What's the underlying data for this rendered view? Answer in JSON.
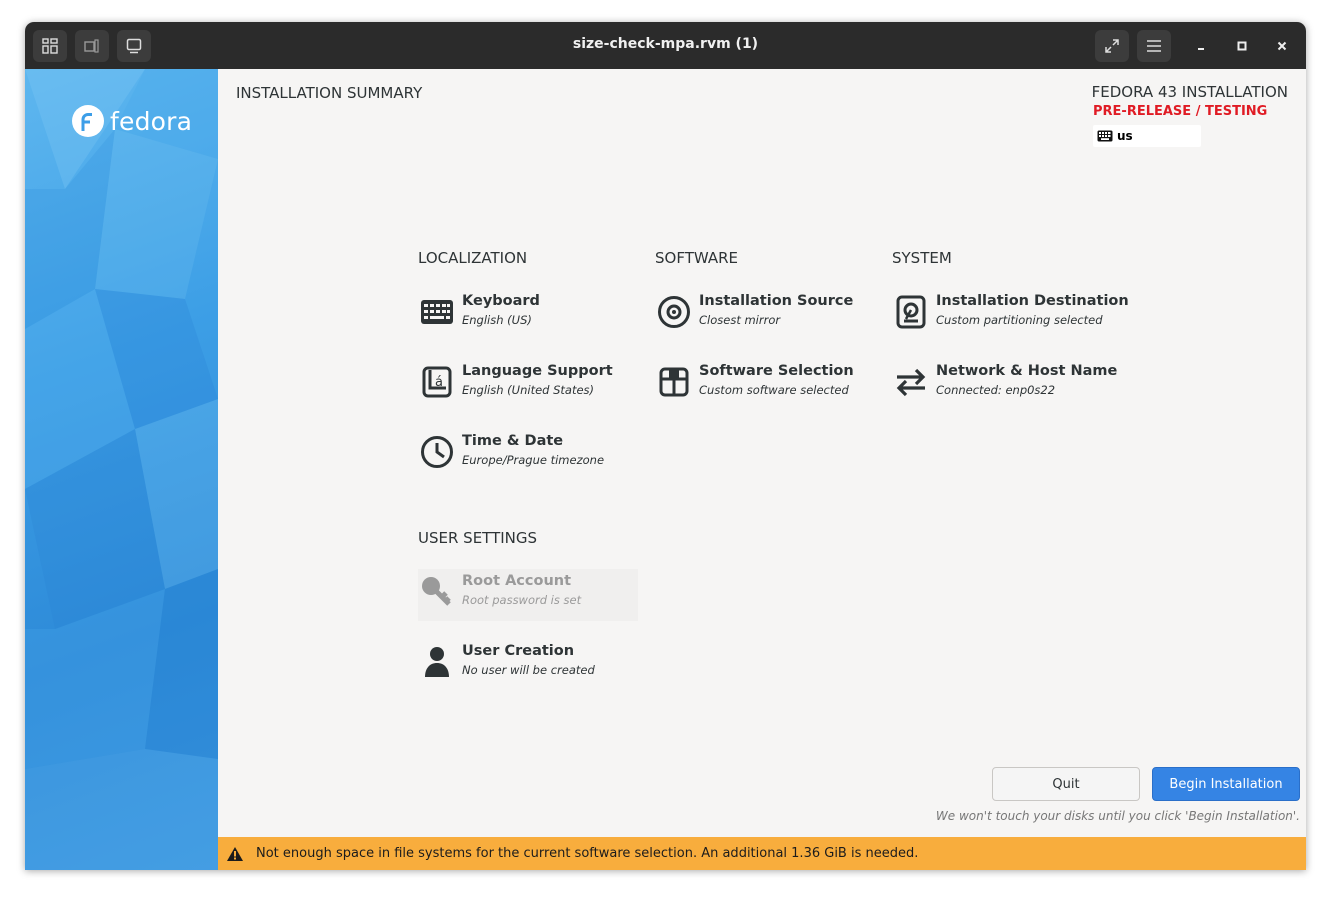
{
  "window": {
    "title": "size-check-mpa.rvm (1)"
  },
  "sidebar": {
    "logo_text": "fedora"
  },
  "header": {
    "page_title": "INSTALLATION SUMMARY",
    "product": "FEDORA 43 INSTALLATION",
    "prerelease": "PRE-RELEASE / TESTING",
    "keyboard_layout": "us"
  },
  "categories": {
    "localization": "LOCALIZATION",
    "software": "SOFTWARE",
    "system": "SYSTEM",
    "user_settings": "USER SETTINGS"
  },
  "spokes": {
    "keyboard": {
      "name": "Keyboard",
      "status": "English (US)"
    },
    "language": {
      "name": "Language Support",
      "status": "English (United States)"
    },
    "time": {
      "name": "Time & Date",
      "status": "Europe/Prague timezone"
    },
    "source": {
      "name": "Installation Source",
      "status": "Closest mirror"
    },
    "software": {
      "name": "Software Selection",
      "status": "Custom software selected"
    },
    "destination": {
      "name": "Installation Destination",
      "status": "Custom partitioning selected"
    },
    "network": {
      "name": "Network & Host Name",
      "status": "Connected: enp0s22"
    },
    "root": {
      "name": "Root Account",
      "status": "Root password is set"
    },
    "user": {
      "name": "User Creation",
      "status": "No user will be created"
    }
  },
  "actions": {
    "quit": "Quit",
    "begin": "Begin Installation",
    "note": "We won't touch your disks until you click 'Begin Installation'."
  },
  "warning": {
    "message": "Not enough space in file systems for the current software selection. An additional 1.36 GiB is needed."
  },
  "colors": {
    "accent": "#3584e4",
    "warning": "#f8ad3d",
    "prerelease": "#e01b24",
    "titlebar": "#2b2b2b"
  }
}
